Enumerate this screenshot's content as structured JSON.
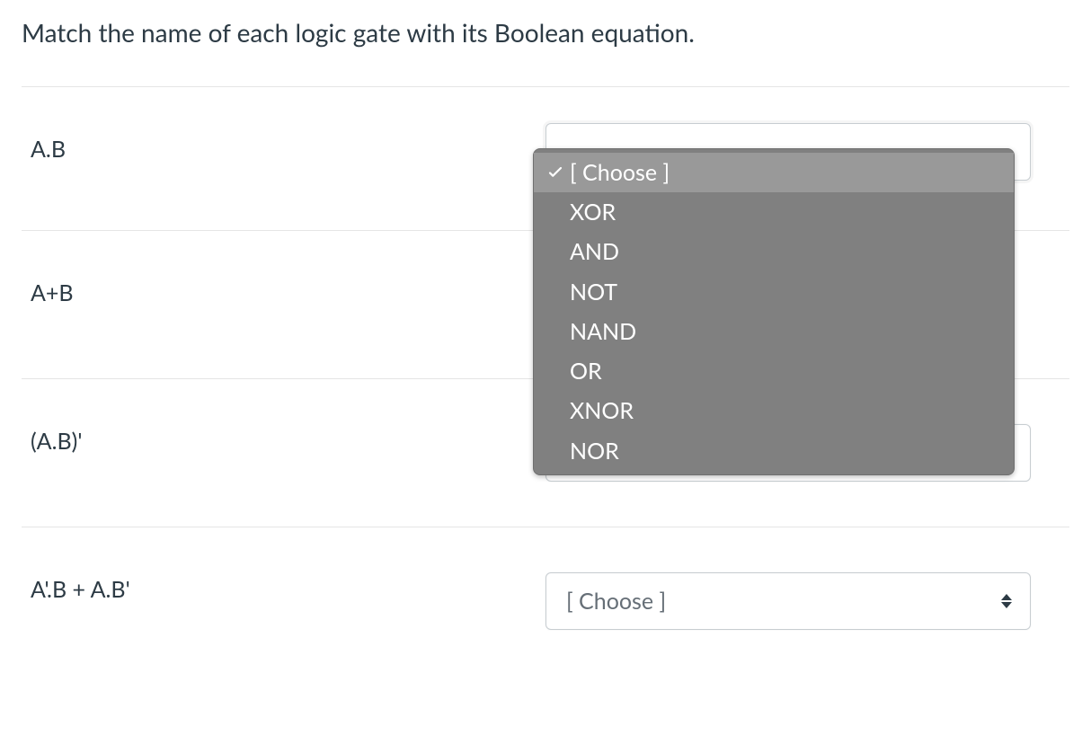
{
  "question": "Match the name of each logic gate with its Boolean equation.",
  "placeholder": "[ Choose ]",
  "rows": [
    {
      "label": "A.B"
    },
    {
      "label": "A+B"
    },
    {
      "label": "(A.B)'"
    },
    {
      "label": "A'.B + A.B'"
    }
  ],
  "dropdown": {
    "selected_index": 0,
    "options": [
      "[ Choose ]",
      "XOR",
      "AND",
      "NOT",
      "NAND",
      "OR",
      "XNOR",
      "NOR"
    ]
  }
}
